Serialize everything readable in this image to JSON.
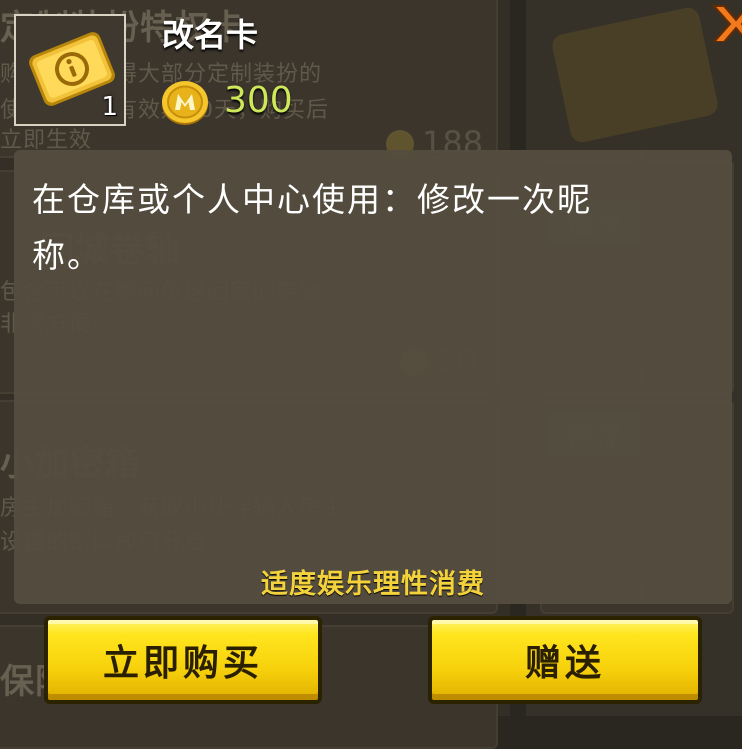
{
  "item": {
    "name": "改名卡",
    "quantity": "1",
    "price": "300",
    "currency_icon": "mini-coin-icon",
    "description": "在仓库或个人中心使用：修改一次昵称。"
  },
  "disclaimer": "适度娱乐理性消费",
  "buttons": {
    "buy": "立即购买",
    "gift": "赠送"
  },
  "close_icon": "close-icon",
  "colors": {
    "accent_yellow": "#f7d20c",
    "price_text": "#cfe85a",
    "disclaimer_text": "#f3d23c",
    "close_orange": "#f07a1c"
  }
}
